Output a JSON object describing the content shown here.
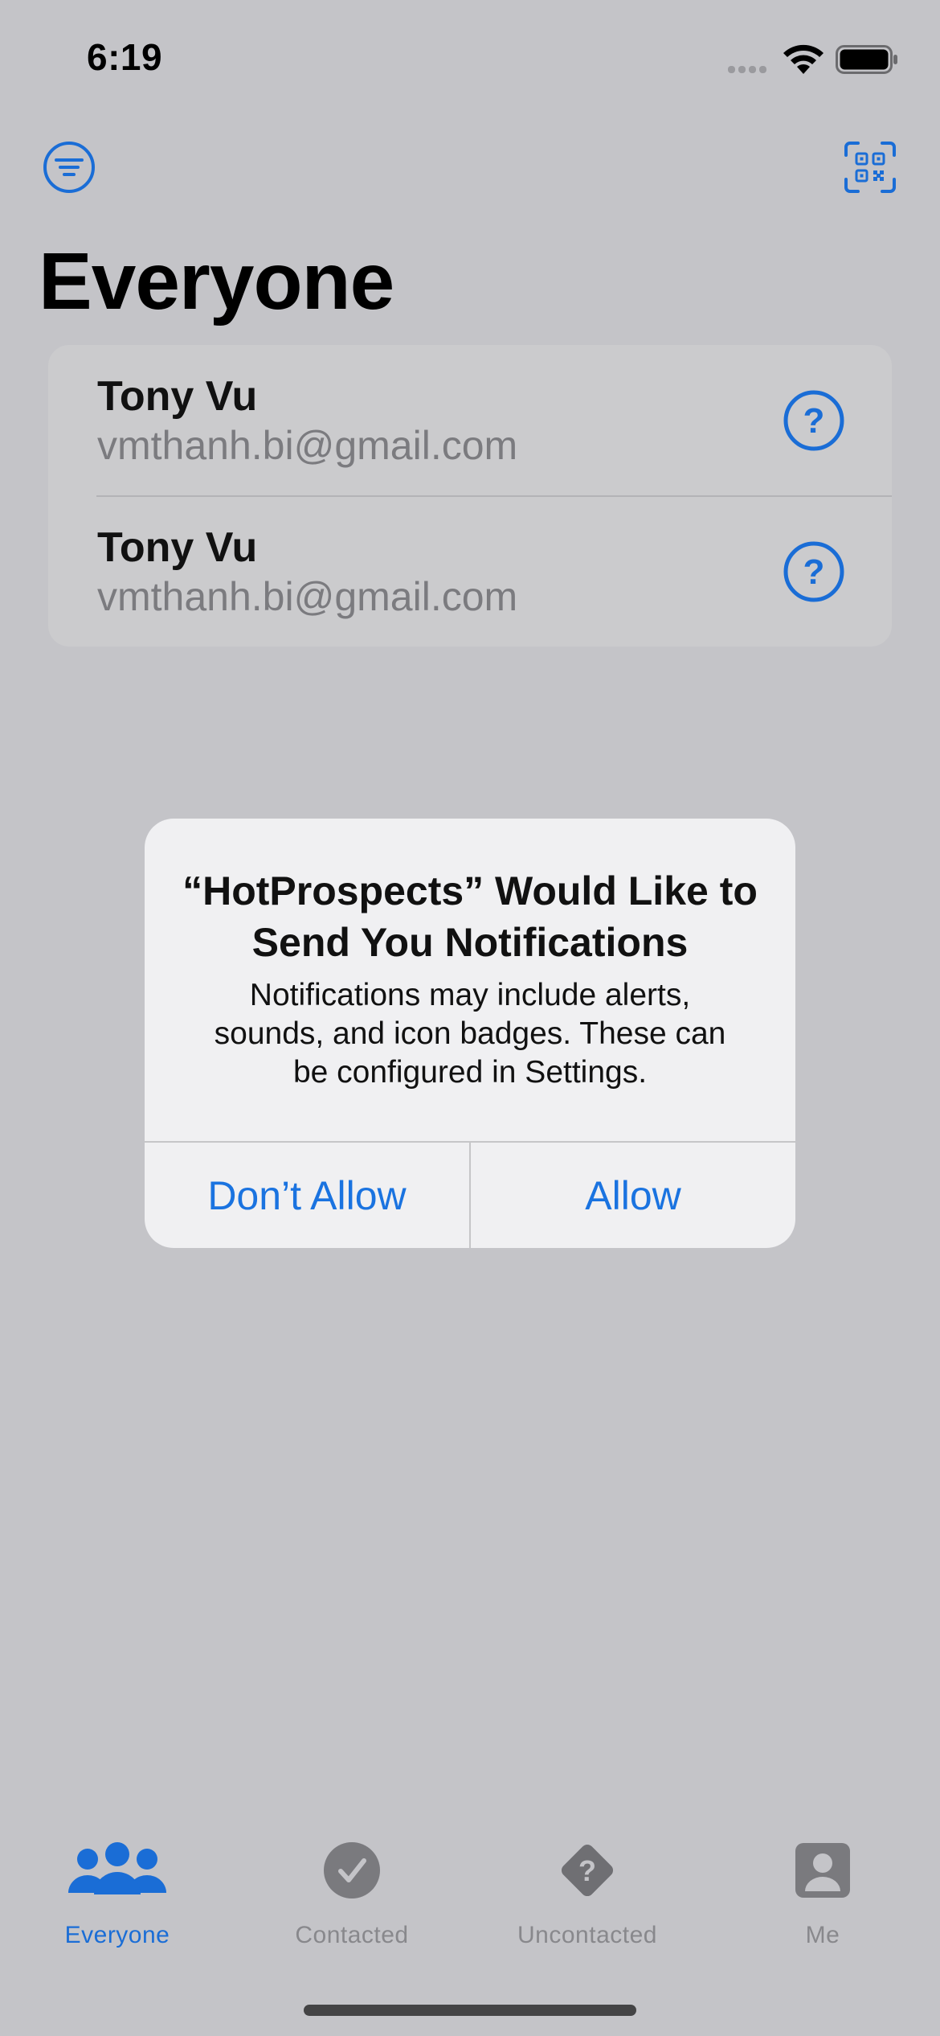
{
  "status_bar": {
    "time": "6:19"
  },
  "toolbar": {
    "filter_icon": "filter-icon",
    "scan_icon": "qrcode-viewfinder-icon"
  },
  "page": {
    "title": "Everyone"
  },
  "prospects": [
    {
      "name": "Tony Vu",
      "email": "vmthanh.bi@gmail.com",
      "status_icon": "questionmark-circle-icon"
    },
    {
      "name": "Tony Vu",
      "email": "vmthanh.bi@gmail.com",
      "status_icon": "questionmark-circle-icon"
    }
  ],
  "alert": {
    "title": "“HotProspects” Would Like to Send You Notifications",
    "message": "Notifications may include alerts, sounds, and icon badges. These can be configured in Settings.",
    "deny_label": "Don’t Allow",
    "allow_label": "Allow"
  },
  "tabs": [
    {
      "label": "Everyone",
      "icon": "person-3-icon",
      "active": true
    },
    {
      "label": "Contacted",
      "icon": "checkmark-circle-icon",
      "active": false
    },
    {
      "label": "Uncontacted",
      "icon": "questionmark-diamond-icon",
      "active": false
    },
    {
      "label": "Me",
      "icon": "person-crop-square-icon",
      "active": false
    }
  ],
  "colors": {
    "accent": "#1a6dd6",
    "background_dimmed": "#c4c4c8",
    "alert_background": "#f0f0f2",
    "inactive_tab": "#88888c"
  }
}
